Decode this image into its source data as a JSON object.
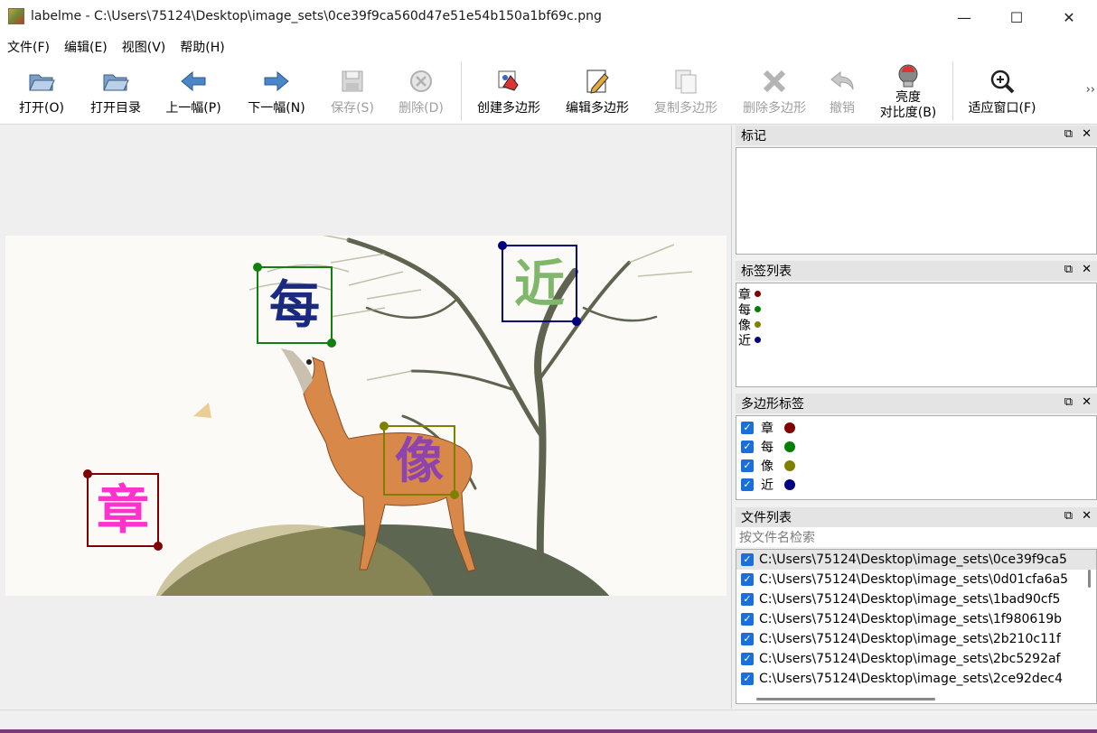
{
  "window": {
    "title": "labelme - C:\\Users\\75124\\Desktop\\image_sets\\0ce39f9ca560d47e51e54b150a1bf69c.png",
    "minimize": "—",
    "maximize": "☐",
    "close": "✕"
  },
  "menu": [
    "文件(F)",
    "编辑(E)",
    "视图(V)",
    "帮助(H)"
  ],
  "toolbar": {
    "open": "打开(O)",
    "open_dir": "打开目录",
    "prev": "上一幅(P)",
    "next": "下一幅(N)",
    "save": "保存(S)",
    "delete": "删除(D)",
    "create_polygon": "创建多边形",
    "edit_polygon": "编辑多边形",
    "copy_polygon": "复制多边形",
    "delete_polygon": "删除多边形",
    "undo": "撤销",
    "brightness_1": "亮度",
    "brightness_2": "对比度(B)",
    "fit_window": "适应窗口(F)",
    "more": "››"
  },
  "canvas": {
    "annotations": [
      {
        "label": "每",
        "color": "#108010"
      },
      {
        "label": "近",
        "color": "#000080"
      },
      {
        "label": "像",
        "color": "#808000"
      },
      {
        "label": "章",
        "color": "#800000"
      }
    ]
  },
  "panels": {
    "flags": {
      "title": "标记"
    },
    "label_list": {
      "title": "标签列表",
      "items": [
        {
          "label": "章",
          "color": "#800000"
        },
        {
          "label": "每",
          "color": "#008000"
        },
        {
          "label": "像",
          "color": "#808000"
        },
        {
          "label": "近",
          "color": "#000080"
        }
      ]
    },
    "polygon_labels": {
      "title": "多边形标签",
      "items": [
        {
          "label": "章",
          "color": "#800000",
          "checked": true
        },
        {
          "label": "每",
          "color": "#008000",
          "checked": true
        },
        {
          "label": "像",
          "color": "#808000",
          "checked": true
        },
        {
          "label": "近",
          "color": "#000080",
          "checked": true
        }
      ]
    },
    "file_list": {
      "title": "文件列表",
      "search_placeholder": "按文件名检索",
      "items": [
        "C:\\Users\\75124\\Desktop\\image_sets\\0ce39f9ca5",
        "C:\\Users\\75124\\Desktop\\image_sets\\0d01cfa6a5",
        "C:\\Users\\75124\\Desktop\\image_sets\\1bad90cf5",
        "C:\\Users\\75124\\Desktop\\image_sets\\1f980619b",
        "C:\\Users\\75124\\Desktop\\image_sets\\2b210c11f",
        "C:\\Users\\75124\\Desktop\\image_sets\\2bc5292af",
        "C:\\Users\\75124\\Desktop\\image_sets\\2ce92dec4"
      ]
    }
  },
  "dock_buttons": {
    "float": "⧉",
    "close": "✕"
  },
  "checkmark": "✓"
}
